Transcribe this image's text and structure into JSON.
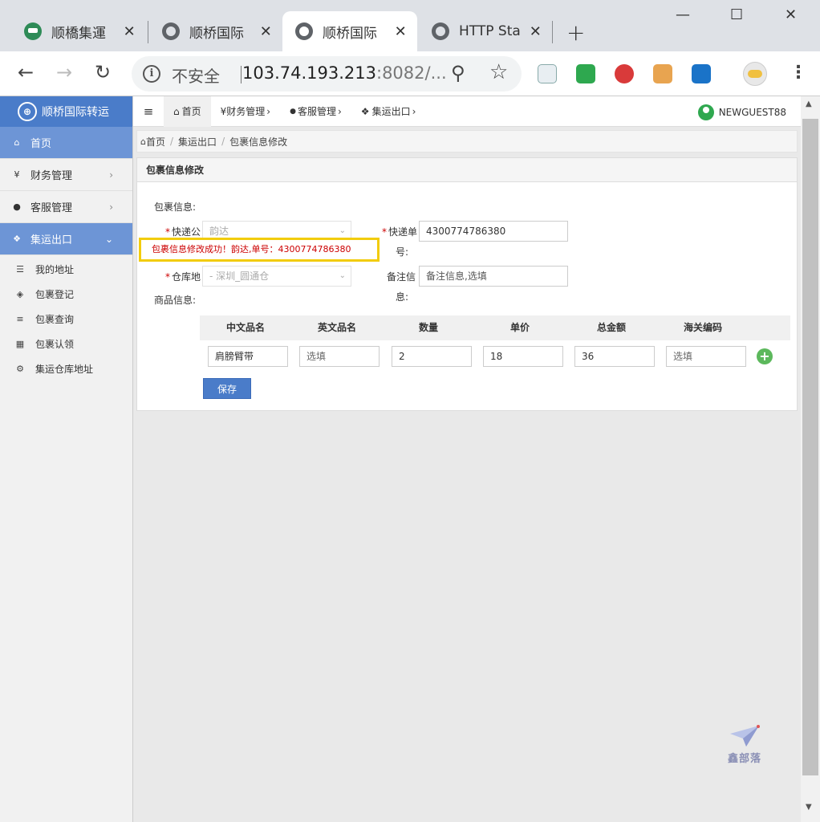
{
  "browser": {
    "tabs": [
      {
        "title": "顺橋集運",
        "active": false
      },
      {
        "title": "顺桥国际",
        "active": false
      },
      {
        "title": "顺桥国际",
        "active": true
      },
      {
        "title": "HTTP Sta",
        "active": false
      }
    ],
    "new_tab": "+",
    "window_controls": {
      "minimize": "—",
      "maximize": "☐",
      "close": "✕"
    },
    "insecure_label": "不安全",
    "url_host": "103.74.193.213",
    "url_rest": ":8082/..."
  },
  "sidebar": {
    "brand": "顺桥国际转运",
    "items": [
      {
        "label": "首页",
        "icon": "home-icon"
      },
      {
        "label": "财务管理",
        "icon": "yen-icon"
      },
      {
        "label": "客服管理",
        "icon": "user-icon"
      },
      {
        "label": "集运出口",
        "icon": "cubes-icon"
      }
    ],
    "sub_items": [
      {
        "label": "我的地址",
        "icon": "list-icon"
      },
      {
        "label": "包裹登记",
        "icon": "cube-icon"
      },
      {
        "label": "包裹查询",
        "icon": "align-icon"
      },
      {
        "label": "包裹认领",
        "icon": "grid-icon"
      },
      {
        "label": "集运仓库地址",
        "icon": "gear-icon"
      }
    ]
  },
  "topnav": {
    "items": [
      "首页",
      "财务管理",
      "客服管理",
      "集运出口"
    ],
    "user": "NEWGUEST88"
  },
  "breadcrumb": [
    "首页",
    "集运出口",
    "包裹信息修改"
  ],
  "panel": {
    "title": "包裹信息修改",
    "section_package": "包裹信息:",
    "section_goods": "商品信息:",
    "courier_label": "快递公",
    "courier_value": "韵达",
    "tracking_label_1": "快递单",
    "tracking_label_2": "号:",
    "tracking_value": "4300774786380",
    "warehouse_label": "仓库地",
    "warehouse_value": "- 深圳_圆通仓",
    "remark_label_1": "备注信",
    "remark_label_2": "息:",
    "remark_placeholder": "备注信息,选填",
    "alert": "包裹信息修改成功！韵达,单号：4300774786380",
    "save": "保存"
  },
  "goods_table": {
    "headers": [
      "中文品名",
      "英文品名",
      "数量",
      "单价",
      "总金额",
      "海关编码"
    ],
    "row": {
      "cn_name": "肩膀臂带",
      "en_name_placeholder": "选填",
      "qty": "2",
      "price": "18",
      "total": "36",
      "hs_placeholder": "选填"
    }
  },
  "watermark": "鑫部落"
}
